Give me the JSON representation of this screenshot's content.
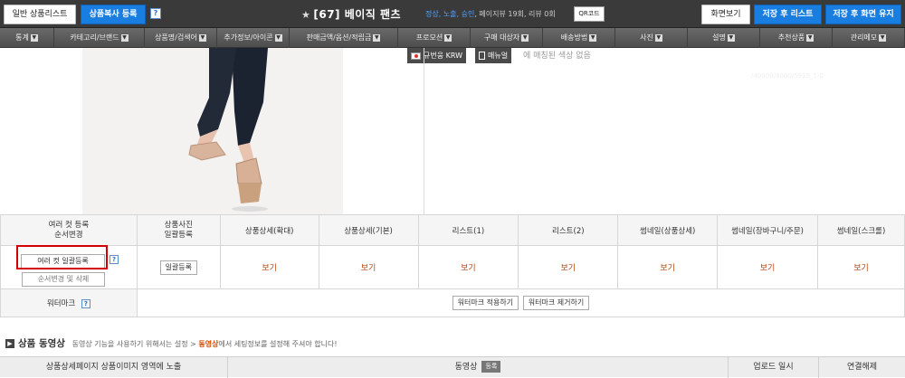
{
  "topbar": {
    "general_list_label": "일반 상품리스트",
    "copy_register_label": "상품복사 등록",
    "help_glyph": "?",
    "title": "[67] 베이직 팬츠",
    "status_prefix": "정상, 노출, 승인",
    "status_suffix": ", 페이지뷰 19회, 리뷰 0회",
    "qr_label": "QR코드",
    "screen_view_label": "화면보기",
    "save_to_list_label": "저장 후 리스트",
    "save_keep_label": "저장 후 화면 유지"
  },
  "nav": [
    {
      "label": "통계",
      "w": 60
    },
    {
      "label": "카테고리/브랜드",
      "w": 100
    },
    {
      "label": "상품명/검색어",
      "w": 80
    },
    {
      "label": "추가정보/아이콘",
      "w": 80
    },
    {
      "label": "판매금액/옵션/적립금",
      "w": 120
    },
    {
      "label": "프로모션",
      "w": 80
    },
    {
      "label": "구매 대상자",
      "w": 80
    },
    {
      "label": "배송방법",
      "w": 80
    },
    {
      "label": "사진",
      "w": 80
    },
    {
      "label": "설명",
      "w": 80
    },
    {
      "label": "추천상품",
      "w": 80
    },
    {
      "label": "관리메모",
      "w": 80
    }
  ],
  "float_bar": {
    "currency_label": "규번웅 KRW",
    "manual_label": "매뉴얼"
  },
  "color_note": "에 매칭된 색상 없음",
  "ghost_text": "/40000/4000/5919_1-0",
  "photo_table": {
    "headers": {
      "multi_cut": "여러 컷 등록\n순서변경",
      "photo_bulk": "상품사진\n일괄등록",
      "detail_large": "상품상세(확대)",
      "detail_basic": "상품상세(기본)",
      "list1": "리스트(1)",
      "list2": "리스트(2)",
      "thumb_detail": "썸네일(상품상세)",
      "thumb_cart": "썸네일(장바구니/주문)",
      "thumb_scroll": "썸네일(스크롤)"
    },
    "multi_cut_button": "여러 컷 일괄등록",
    "order_button": "순서변경 및 삭제",
    "bulk_button": "일괄등록",
    "view_label": "보기",
    "watermark_label": "워터마크",
    "watermark_apply": "워터마크 적용하기",
    "watermark_remove": "워터마크 제거하기"
  },
  "video_section": {
    "title": "상품 동영상",
    "desc_pre": "동영상 기능을 사용하기 위해서는 설정 >",
    "desc_hl": "동영상",
    "desc_post": "에서 세팅정보를 설정해 주셔야 합니다!",
    "col_display": "상품상세페이지 상품이미지 영역에 노출",
    "col_video": "동영상",
    "col_register": "등록",
    "col_upload": "업로드 일시",
    "col_unlink": "연결해제"
  }
}
